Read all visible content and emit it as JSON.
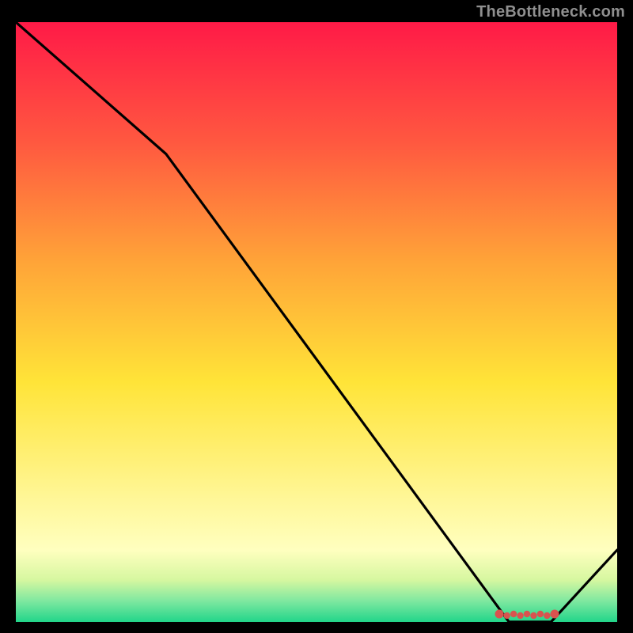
{
  "attribution": "TheBottleneck.com",
  "chart_data": {
    "type": "line",
    "title": "",
    "xlabel": "",
    "ylabel": "",
    "xlim": [
      0,
      100
    ],
    "ylim": [
      0,
      100
    ],
    "x": [
      0,
      25,
      82,
      89,
      100
    ],
    "values": [
      100,
      78,
      0,
      0,
      12
    ],
    "gradient_stops": [
      {
        "offset": 0.0,
        "color": "#ff1a47"
      },
      {
        "offset": 0.2,
        "color": "#ff5840"
      },
      {
        "offset": 0.4,
        "color": "#ffa438"
      },
      {
        "offset": 0.6,
        "color": "#ffe438"
      },
      {
        "offset": 0.8,
        "color": "#fff79a"
      },
      {
        "offset": 0.88,
        "color": "#ffffbf"
      },
      {
        "offset": 0.93,
        "color": "#d6f7a0"
      },
      {
        "offset": 0.965,
        "color": "#7fe8a0"
      },
      {
        "offset": 1.0,
        "color": "#22d58a"
      }
    ],
    "minimum_marker": {
      "x_start": 80,
      "x_end": 90,
      "y": 0,
      "color": "#d9534f"
    }
  }
}
